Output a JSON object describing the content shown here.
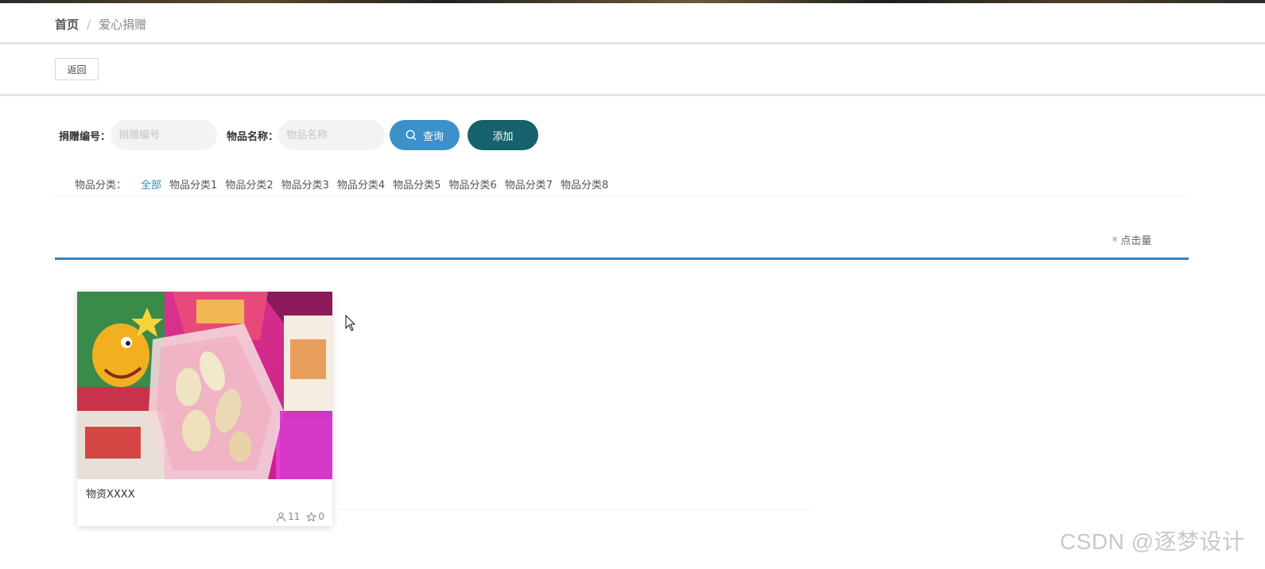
{
  "breadcrumb": {
    "home": "首页",
    "separator": "/",
    "current": "爱心捐赠"
  },
  "toolbar": {
    "back_label": "返回"
  },
  "search": {
    "donation_no_label": "捐赠编号：",
    "donation_no_placeholder": "捐赠编号",
    "item_name_label": "物品名称：",
    "item_name_placeholder": "物品名称",
    "query_label": "查询",
    "add_label": "添加"
  },
  "categories": {
    "label": "物品分类：",
    "items": [
      "全部",
      "物品分类1",
      "物品分类2",
      "物品分类3",
      "物品分类4",
      "物品分类5",
      "物品分类6",
      "物品分类7",
      "物品分类8"
    ],
    "active": "全部"
  },
  "sort": {
    "icon": "sort-icon",
    "label": "点击量"
  },
  "items": [
    {
      "title": "物资XXXX",
      "views": "11",
      "favorites": "0",
      "image": "snack-bag-photo"
    }
  ],
  "colors": {
    "primary": "#3d91c9",
    "add_button": "#17616c",
    "divider": "#2f86c2",
    "active_category": "#2f8cc8"
  },
  "watermark": "CSDN @逐梦设计"
}
